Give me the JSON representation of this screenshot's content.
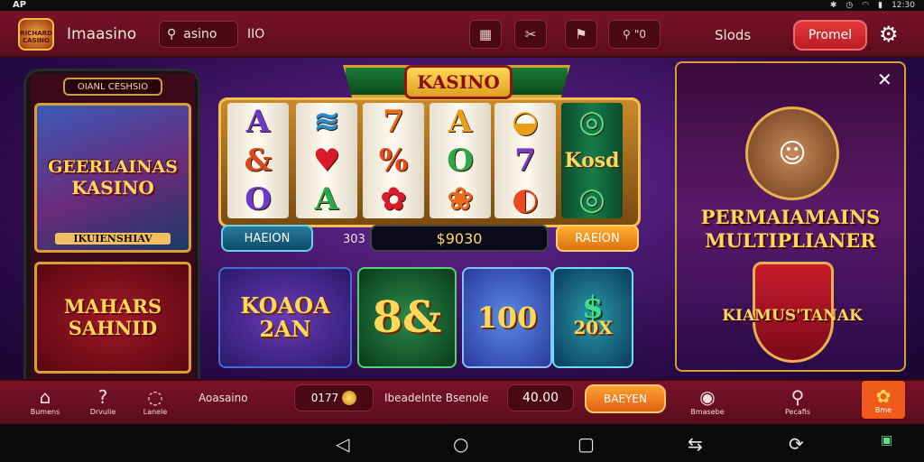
{
  "statusbar": {
    "left": "AP",
    "right": "12:30"
  },
  "header": {
    "logo_text": "RICHARD CASINO",
    "app_name": "Imaasino",
    "search_label": "asino",
    "search_extra": "IIO",
    "slots_label": "Slods",
    "promo_label": "Promel"
  },
  "phone": {
    "pill_label": "OIANL CESHSIO",
    "card1_title1": "GEERLAINAS",
    "card1_title2": "KASINO",
    "card1_footer": "IKUIENSHIAV",
    "card2_title": "MAHARS SAHNID"
  },
  "slot": {
    "title": "KASINO",
    "reels": [
      [
        "A",
        "&",
        "O"
      ],
      [
        "≋",
        "♥",
        "A"
      ],
      [
        "7",
        "%",
        "✿"
      ],
      [
        "A",
        "O",
        "❀"
      ],
      [
        "◒",
        "7",
        "◐"
      ],
      [
        "◎",
        "Kosd",
        "◎"
      ]
    ],
    "left_button": "HAEION",
    "counter": "303",
    "display_value": "$9030",
    "right_button": "RAEION"
  },
  "tiles": {
    "tile1": "KOAOA 2AN",
    "tile2": "8&",
    "tile3": "100",
    "tile4_top": "$",
    "tile4_bottom": "20X"
  },
  "side_panel": {
    "close_glyph": "✕",
    "title": "PERMAIAMAINS MULTIPLIANER",
    "label": "KIAMUS'TANAK"
  },
  "bottom": {
    "nav": [
      {
        "icon": "⌂",
        "label": "Bumens"
      },
      {
        "icon": "?",
        "label": "Drvulie"
      },
      {
        "icon": "◌",
        "label": "Lanele"
      }
    ],
    "section_label": "Aoasaino",
    "coins": "0177",
    "middle_text": "Ibeadelnte Bsenole",
    "value": "40.00",
    "orange_button": "BAEYEN",
    "right_nav": [
      {
        "icon": "◉",
        "label": "Bmasebe"
      },
      {
        "icon": "⚲",
        "label": "Pecafis"
      }
    ],
    "flower_label": "Bme"
  }
}
